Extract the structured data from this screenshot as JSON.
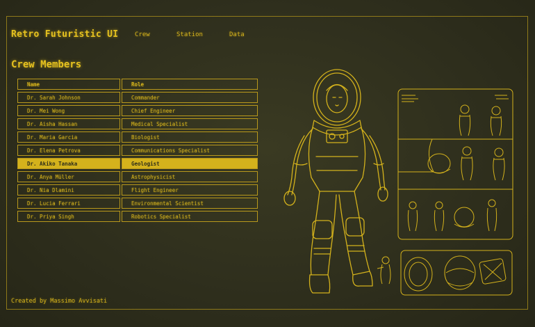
{
  "app": {
    "title": "Retro Futuristic UI"
  },
  "nav": [
    {
      "label": "Crew"
    },
    {
      "label": "Station"
    },
    {
      "label": "Data"
    }
  ],
  "crew": {
    "title": "Crew Members",
    "columns": [
      "Name",
      "Role"
    ],
    "selected_index": 5,
    "rows": [
      {
        "name": "Dr. Sarah Johnson",
        "role": "Commander"
      },
      {
        "name": "Dr. Mei Wong",
        "role": "Chief Engineer"
      },
      {
        "name": "Dr. Aisha Hassan",
        "role": "Medical Specialist"
      },
      {
        "name": "Dr. Maria Garcia",
        "role": "Biologist"
      },
      {
        "name": "Dr. Elena Petrova",
        "role": "Communications Specialist"
      },
      {
        "name": "Dr. Akiko Tanaka",
        "role": "Geologist"
      },
      {
        "name": "Dr. Anya Müller",
        "role": "Astrophysicist"
      },
      {
        "name": "Dr. Nia Dlamini",
        "role": "Flight Engineer"
      },
      {
        "name": "Dr. Lucia Ferrari",
        "role": "Environmental Scientist"
      },
      {
        "name": "Dr. Priya Singh",
        "role": "Robotics Specialist"
      }
    ]
  },
  "footer": {
    "credit": "Created by Massimo Avvisati"
  },
  "colors": {
    "accent": "#d4b21c",
    "background": "#2f2f1d",
    "selected_text": "#2e2e1a"
  },
  "icons": [
    "astronaut-illustration-icon",
    "spacesuit-sheet-icon",
    "helmet-gear-icon"
  ]
}
